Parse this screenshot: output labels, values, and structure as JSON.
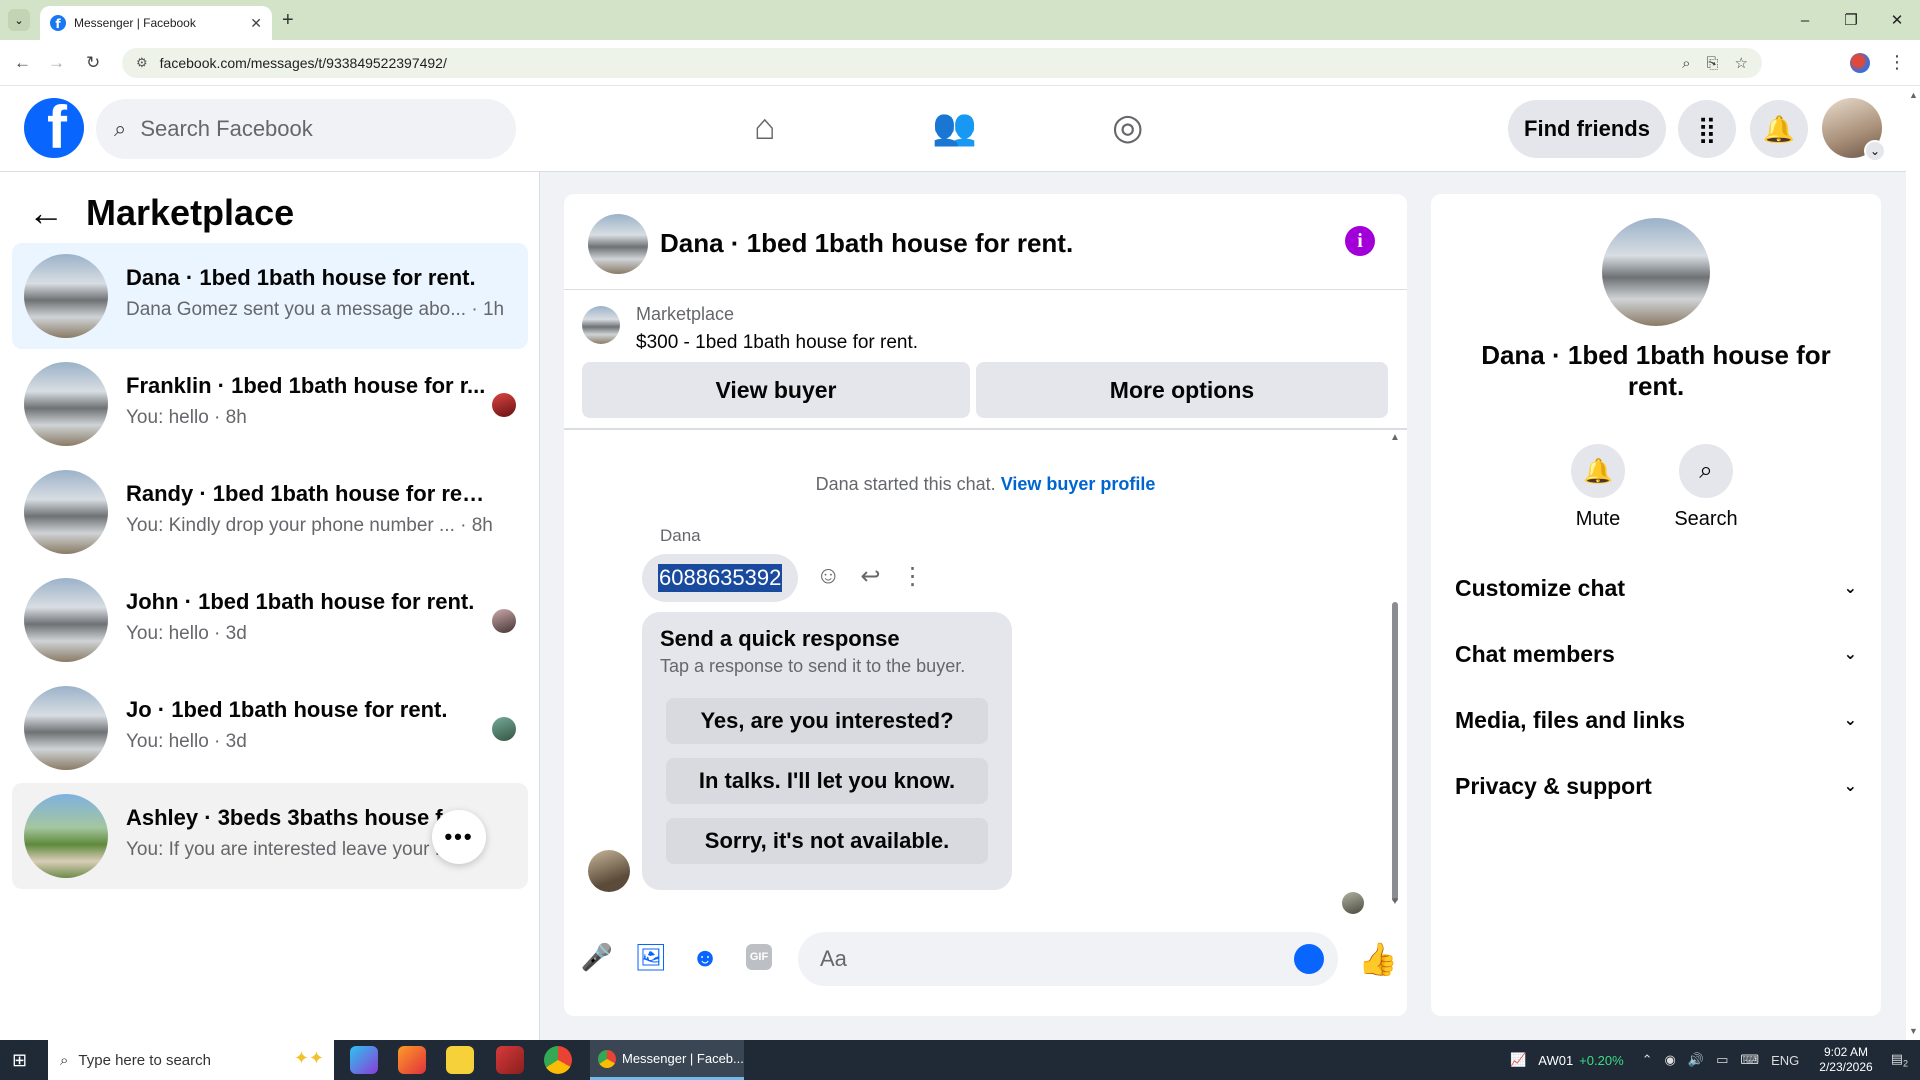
{
  "browser": {
    "tab_title": "Messenger | Facebook",
    "new_tab": "+",
    "url": "facebook.com/messages/t/933849522397492/",
    "window_controls": [
      "–",
      "❐",
      "✕"
    ],
    "icons": [
      "back-icon",
      "forward-icon",
      "reload-icon",
      "zoom-icon",
      "install-icon",
      "star-icon",
      "profile-icon",
      "menu-icon"
    ]
  },
  "fb_nav": {
    "logo": "f",
    "search_placeholder": "Search Facebook",
    "find_friends": "Find friends",
    "icons": [
      "home-icon",
      "friends-icon",
      "groups-icon",
      "apps-grid-icon",
      "notifications-bell-icon",
      "account-avatar"
    ]
  },
  "left": {
    "title": "Marketplace",
    "conversations": [
      {
        "name": "Dana · 1bed 1bath house for rent.",
        "preview": "Dana Gomez sent you a message abo... · 1h",
        "state": "active"
      },
      {
        "name": "Franklin · 1bed 1bath house for r...",
        "preview": "You: hello · 8h",
        "state": "normal"
      },
      {
        "name": "Randy · 1bed 1bath house for rent.",
        "preview": "You: Kindly drop your phone number ... · 8h",
        "state": "normal"
      },
      {
        "name": "John · 1bed 1bath house for rent.",
        "preview": "You: hello · 3d",
        "state": "normal"
      },
      {
        "name": "Jo · 1bed 1bath house for rent.",
        "preview": "You: hello · 3d",
        "state": "normal"
      },
      {
        "name": "Ashley · 3beds 3baths house fo...",
        "preview": "You: If you are interested leave your ... 4d",
        "state": "hover"
      }
    ],
    "more_button": "•••"
  },
  "chat": {
    "title": "Dana · 1bed 1bath house for rent.",
    "info_icon": "i",
    "listing_label": "Marketplace",
    "listing_price": "$300 - 1bed 1bath house for rent.",
    "view_buyer": "View buyer",
    "more_options": "More options",
    "started_text": "Dana started this chat.",
    "view_buyer_profile": "View buyer profile",
    "sender": "Dana",
    "message": "6088635392",
    "quick_title": "Send a quick response",
    "quick_sub": "Tap a response to send it to the buyer.",
    "quick_responses": [
      "Yes, are you interested?",
      "In talks. I'll let you know.",
      "Sorry, it's not available."
    ],
    "composer_placeholder": "Aa"
  },
  "right": {
    "name": "Dana · 1bed 1bath house for rent.",
    "mute": "Mute",
    "search": "Search",
    "sections": [
      "Customize chat",
      "Chat members",
      "Media, files and links",
      "Privacy & support"
    ]
  },
  "taskbar": {
    "search_placeholder": "Type here to search",
    "active_window": "Messenger | Faceb...",
    "ticker": "AW01",
    "ticker_change": "+0.20%",
    "language": "ENG",
    "time": "9:02 AM",
    "date": "2/23/2026",
    "notif_count": "2"
  }
}
